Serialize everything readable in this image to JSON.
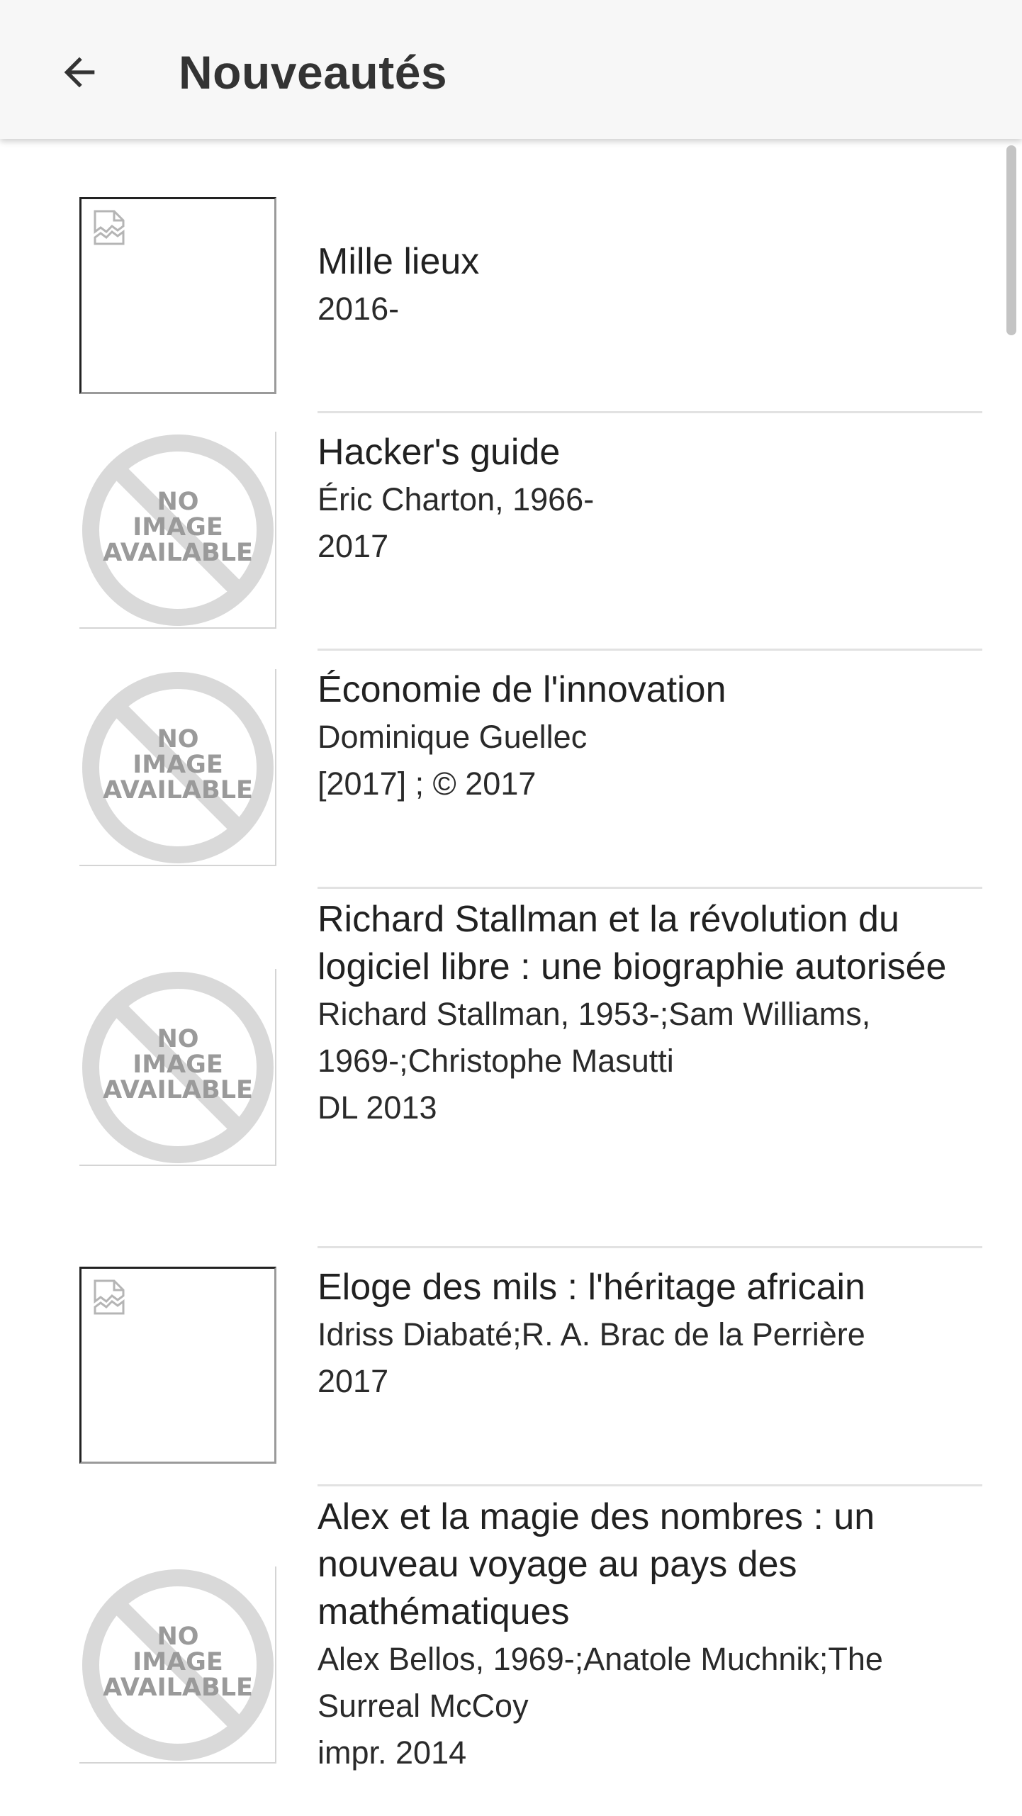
{
  "app_bar": {
    "title": "Nouveautés",
    "back_icon": "arrow-left-icon"
  },
  "placeholder": {
    "no_image_line1": "NO",
    "no_image_line2": "IMAGE",
    "no_image_line3": "AVAILABLE"
  },
  "items": [
    {
      "title": "Mille lieux",
      "date": "2016-",
      "thumbnail": "broken-image-icon"
    },
    {
      "title": "Hacker's guide",
      "author": "Éric Charton, 1966-",
      "date": "2017",
      "thumbnail": "no-image-available"
    },
    {
      "title": "Économie de l'innovation",
      "author": "Dominique Guellec",
      "date": "[2017] ; © 2017",
      "thumbnail": "no-image-available"
    },
    {
      "title": "Richard Stallman et la révolution du logiciel libre : une biographie autorisée",
      "author": "Richard Stallman, 1953-;Sam Williams, 1969-;Christophe Masutti",
      "date": "DL 2013",
      "thumbnail": "no-image-available"
    },
    {
      "title": "Eloge des mils : l'héritage africain",
      "author": "Idriss Diabaté;R. A. Brac de la Perrière",
      "date": "2017",
      "thumbnail": "broken-image-icon"
    },
    {
      "title": "Alex et la magie des nombres : un nouveau voyage au pays des mathématiques",
      "author": "Alex Bellos, 1969-;Anatole Muchnik;The Surreal McCoy",
      "date": "impr. 2014",
      "thumbnail": "no-image-available"
    }
  ],
  "colors": {
    "app_bar_bg": "#f7f7f7",
    "divider": "#e2e2e2",
    "placeholder_gray": "#d9d9d9"
  }
}
